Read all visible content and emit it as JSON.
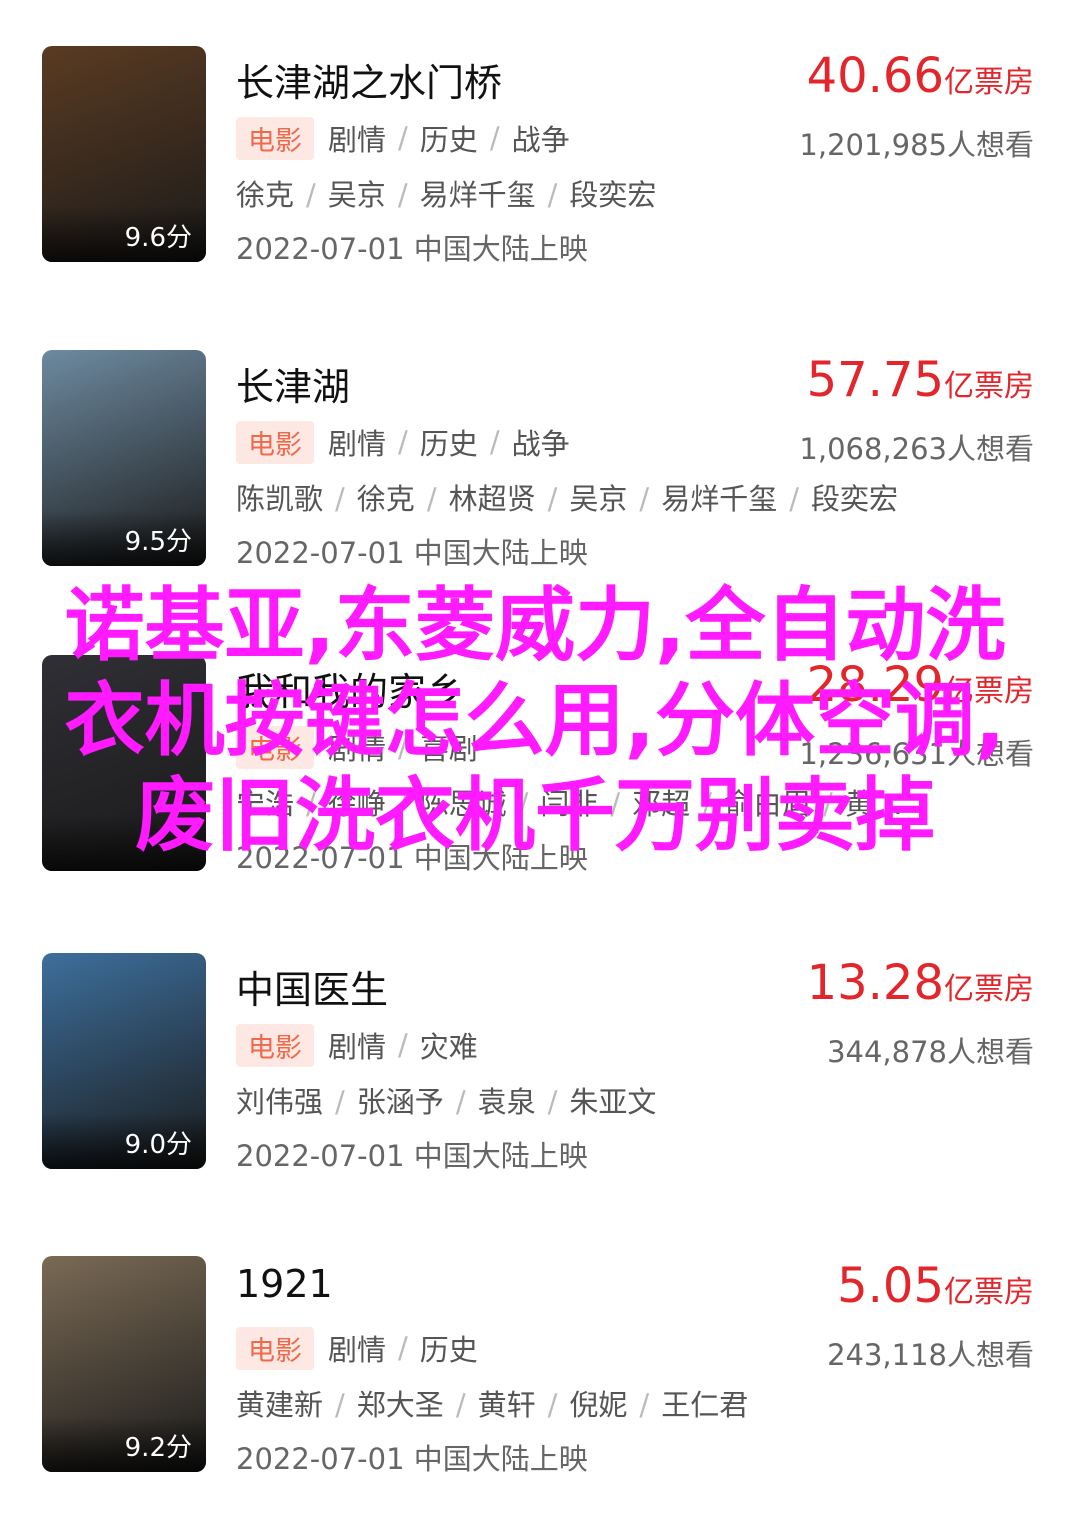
{
  "movies": [
    {
      "title": "长津湖之水门桥",
      "score": "9.6分",
      "box_num": "40.66",
      "box_unit": "亿票房",
      "tag": "电影",
      "genres": [
        "剧情",
        "历史",
        "战争"
      ],
      "want": "1,201,985人想看",
      "cast": [
        "徐克",
        "吴京",
        "易烊千玺",
        "段奕宏"
      ],
      "release": "2022-07-01 中国大陆上映",
      "poster_color": "#5a3b22"
    },
    {
      "title": "长津湖",
      "score": "9.5分",
      "box_num": "57.75",
      "box_unit": "亿票房",
      "tag": "电影",
      "genres": [
        "剧情",
        "历史",
        "战争"
      ],
      "want": "1,068,263人想看",
      "cast": [
        "陈凯歌",
        "徐克",
        "林超贤",
        "吴京",
        "易烊千玺",
        "段奕宏"
      ],
      "release": "2022-07-01 中国大陆上映",
      "poster_color": "#6d8aa0"
    },
    {
      "title": "我和我的家乡",
      "score": "",
      "box_num": "28.29",
      "box_unit": "亿票房",
      "tag": "电影",
      "genres": [
        "剧情",
        "喜剧"
      ],
      "want": "1,236,631人想看",
      "cast": [
        "宁浩",
        "徐峥",
        "陈思诚",
        "闫非",
        "邓超",
        "俞白眉",
        "黄…"
      ],
      "release": "2022-07-01 中国大陆上映",
      "poster_color": "#2f2f35"
    },
    {
      "title": "中国医生",
      "score": "9.0分",
      "box_num": "13.28",
      "box_unit": "亿票房",
      "tag": "电影",
      "genres": [
        "剧情",
        "灾难"
      ],
      "want": "344,878人想看",
      "cast": [
        "刘伟强",
        "张涵予",
        "袁泉",
        "朱亚文"
      ],
      "release": "2022-07-01 中国大陆上映",
      "poster_color": "#3d6f9c"
    },
    {
      "title": "1921",
      "score": "9.2分",
      "box_num": "5.05",
      "box_unit": "亿票房",
      "tag": "电影",
      "genres": [
        "剧情",
        "历史"
      ],
      "want": "243,118人想看",
      "cast": [
        "黄建新",
        "郑大圣",
        "黄轩",
        "倪妮",
        "王仁君"
      ],
      "release": "2022-07-01 中国大陆上映",
      "poster_color": "#7a6a55"
    }
  ],
  "overlay_text": "诺基亚,东菱威力,全自动洗衣机按键怎么用,分体空调,废旧洗衣机千万别卖掉"
}
